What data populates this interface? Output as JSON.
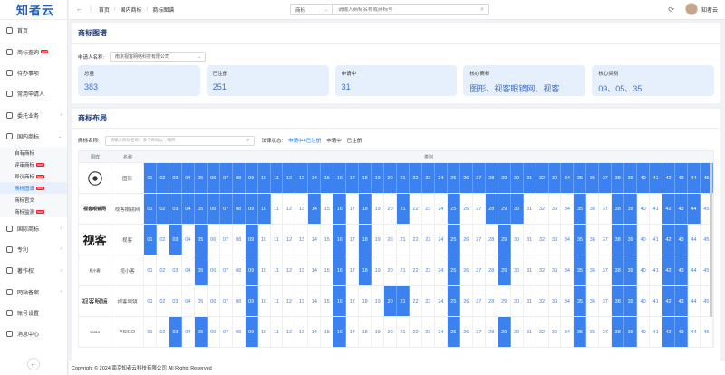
{
  "app": {
    "logo": "知者云"
  },
  "sidebar": {
    "items": [
      {
        "label": "首页",
        "icon": "home-icon",
        "hot": ""
      },
      {
        "label": "商标查询",
        "icon": "search-icon",
        "hot": "HOT"
      },
      {
        "label": "待办事项",
        "icon": "todo-icon",
        "hot": ""
      },
      {
        "label": "常用申请人",
        "icon": "user-icon",
        "hot": ""
      },
      {
        "label": "委托业务",
        "icon": "briefcase-icon",
        "hot": "",
        "arrow": "›"
      },
      {
        "label": "国内商标",
        "icon": "trademark-icon",
        "hot": "",
        "arrow": "⌄"
      }
    ],
    "subitems": [
      {
        "label": "自有商标",
        "hot": ""
      },
      {
        "label": "评审商标",
        "hot": "NEW"
      },
      {
        "label": "异议商标",
        "hot": "NEW"
      },
      {
        "label": "商标图谱",
        "hot": "NEW",
        "active": true
      },
      {
        "label": "商标官文",
        "hot": ""
      },
      {
        "label": "商标监测",
        "hot": "NEW"
      }
    ],
    "items2": [
      {
        "label": "国际商标",
        "icon": "globe-icon",
        "hot": "",
        "arrow": "›"
      },
      {
        "label": "专利",
        "icon": "patent-icon",
        "hot": "",
        "arrow": "›"
      },
      {
        "label": "著作权",
        "icon": "copyright-icon",
        "hot": "",
        "arrow": "›"
      },
      {
        "label": "网站备案",
        "icon": "website-icon",
        "hot": "",
        "arrow": "›"
      },
      {
        "label": "账号设置",
        "icon": "account-icon",
        "hot": ""
      },
      {
        "label": "消息中心",
        "icon": "message-icon",
        "hot": ""
      }
    ],
    "collapse": "←"
  },
  "topbar": {
    "back": "←",
    "forward": "|",
    "breadcrumb": [
      "首页",
      "国内商标",
      "商标图谱"
    ],
    "search_type": "商标",
    "search_placeholder": "请输入商标名称或商标号",
    "user": "知者云",
    "refresh": "⟳"
  },
  "card1": {
    "title": "商标图谱",
    "applicant_label": "申请人名称:",
    "applicant_value": "南京视客网络科技有限公司",
    "stats": [
      {
        "label": "总量",
        "value": "383"
      },
      {
        "label": "已注册",
        "value": "251"
      },
      {
        "label": "申请中",
        "value": "31"
      },
      {
        "label": "核心商标",
        "value": "图形、视客眼镜网、视客"
      },
      {
        "label": "核心类别",
        "value": "09、05、35"
      }
    ]
  },
  "card2": {
    "title": "商标布局",
    "name_label": "商标名称:",
    "name_placeholder": "请输入商标名称，多个商标以\",\"隔开",
    "status_label": "法律状态:",
    "status_options": [
      "申请中+已注册",
      "申请中",
      "已注册"
    ],
    "grid_headers": [
      "图样",
      "名称",
      "类别"
    ],
    "rows": [
      {
        "image": "[logo]",
        "name": "图形",
        "on": [
          1,
          2,
          3,
          4,
          5,
          6,
          7,
          8,
          9,
          10,
          11,
          12,
          13,
          14,
          15,
          16,
          17,
          18,
          19,
          20,
          21,
          22,
          23,
          24,
          25,
          26,
          27,
          28,
          29,
          30,
          31,
          32,
          33,
          34,
          35,
          36,
          37,
          38,
          39,
          40,
          41,
          42,
          43,
          44,
          45
        ]
      },
      {
        "image": "视客眼镜网",
        "name": "视客眼镜网",
        "on": [
          1,
          2,
          3,
          4,
          5,
          6,
          7,
          8,
          9,
          10,
          14,
          16,
          18,
          21,
          25,
          28,
          29,
          30,
          35,
          38,
          39,
          42,
          43,
          44
        ]
      },
      {
        "image": "视客",
        "name": "视客",
        "on": [
          1,
          3,
          5,
          9,
          16,
          18,
          25,
          29,
          35,
          38,
          39,
          42,
          43
        ]
      },
      {
        "image": "视小客",
        "name": "视小客",
        "on": [
          5,
          9,
          16,
          18,
          25,
          29,
          35,
          38,
          39,
          42,
          43
        ]
      },
      {
        "image": "视客眼镜",
        "name": "视客眼镜",
        "on": [
          9,
          16,
          20,
          21,
          25,
          35,
          38,
          39,
          42,
          43
        ]
      },
      {
        "image": "VSIGO",
        "name": "VSIGO",
        "on": [
          3,
          5,
          9,
          16,
          25,
          29,
          35,
          38,
          39,
          42,
          43
        ]
      }
    ]
  },
  "footer": "Copyright © 2024 南京知者云科技有限公司 All Rights Reserved",
  "colors": {
    "accent": "#3b82f0",
    "card_bg": "#e6f0fc",
    "stat_value": "#3a6fd8"
  }
}
